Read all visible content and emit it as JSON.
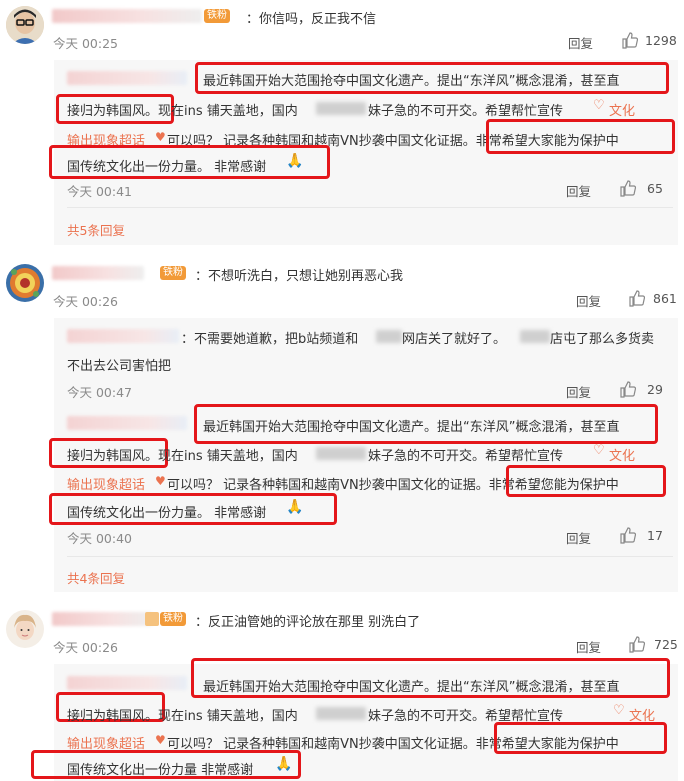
{
  "comments": [
    {
      "badge": "铁粉",
      "text": "：你信吗，反正我不信",
      "time": "今天 00:25",
      "reply_label": "回复",
      "likes": "1298",
      "replies": [
        {
          "lines": [
            "最近韩国开始大范围抢夺中国文化遗产。提出“东洋风”概念混淆，甚至直",
            "接归为韩国风。现在ins 铺天盖地，国内",
            "妹子急的不可开交。希望帮忙宣传",
            "文化",
            "输出现象超话",
            "可以吗？ 记录各种韩国和越南VN抄袭中国文化证据。非常希望大家能为保护中",
            "国传统文化出一份力量。 非常感谢"
          ],
          "time": "今天 00:41",
          "reply_label": "回复",
          "likes": "65"
        }
      ],
      "more": "共5条回复"
    },
    {
      "badge": "铁粉",
      "text": "：不想听洗白，只想让她别再恶心我",
      "time": "今天 00:26",
      "reply_label": "回复",
      "likes": "861",
      "replies": [
        {
          "lines": [
            "：不需要她道歉，把b站频道和",
            "网店关了就好了。",
            "店屯了那么多货卖",
            "不出去公司害怕把"
          ],
          "time": "今天 00:47",
          "reply_label": "回复",
          "likes": "29"
        },
        {
          "lines": [
            "最近韩国开始大范围抢夺中国文化遗产。提出“东洋风”概念混淆，甚至直",
            "接归为韩国风。现在ins 铺天盖地，国内",
            "妹子急的不可开交。希望帮忙宣传",
            "文化",
            "输出现象超话",
            "可以吗？ 记录各种韩国和越南VN抄袭中国文化的证据。非常希望您能为保护中",
            "国传统文化出一份力量。 非常感谢"
          ],
          "time": "今天 00:40",
          "reply_label": "回复",
          "likes": "17"
        }
      ],
      "more": "共4条回复"
    },
    {
      "badge": "铁粉",
      "text": "：反正油管她的评论放在那里 别洗白了",
      "time": "今天 00:26",
      "reply_label": "回复",
      "likes": "725",
      "replies": [
        {
          "lines": [
            "最近韩国开始大范围抢夺中国文化遗产。提出“东洋风”概念混淆，甚至直",
            "接归为韩国风。现在ins 铺天盖地，国内",
            "妹子急的不可开交。希望帮忙宣传",
            "文化",
            "输出现象超话",
            "可以吗？ 记录各种韩国和越南VN抄袭中国文化证据。非常希望大家能为保护中",
            "国传统文化出一份力量 非常感谢"
          ]
        }
      ]
    }
  ],
  "icons": {
    "like": "thumbs-up-icon",
    "heart": "heart-icon",
    "pray": "pray-emoji-icon",
    "chaohua": "super-topic-icon"
  },
  "colors": {
    "highlight": "#e4161a",
    "link": "#eb7350",
    "badge": "#f29a38",
    "reply_bg": "#f7f7f7"
  }
}
